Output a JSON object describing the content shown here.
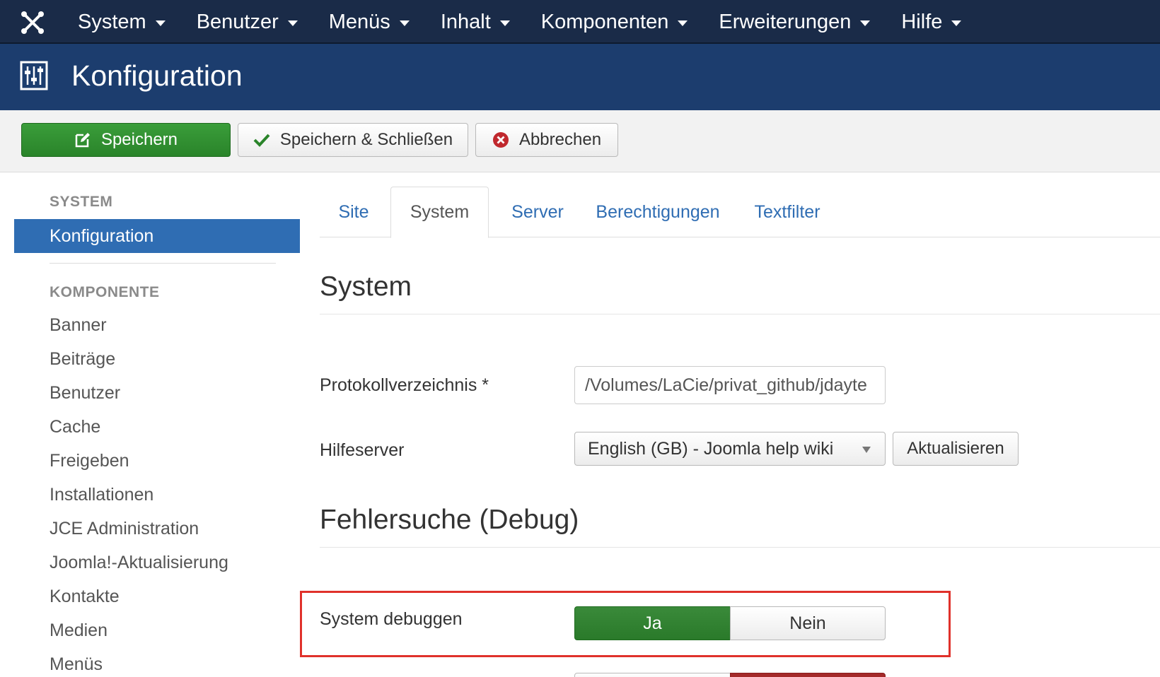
{
  "topnav": {
    "logo_icon": "joomla-logo-icon",
    "items": [
      {
        "label": "System"
      },
      {
        "label": "Benutzer"
      },
      {
        "label": "Menüs"
      },
      {
        "label": "Inhalt"
      },
      {
        "label": "Komponenten"
      },
      {
        "label": "Erweiterungen"
      },
      {
        "label": "Hilfe"
      }
    ]
  },
  "titlebar": {
    "icon": "sliders-icon",
    "title": "Konfiguration"
  },
  "toolbar": {
    "save_label": "Speichern",
    "save_close_label": "Speichern & Schließen",
    "cancel_label": "Abbrechen"
  },
  "sidebar": {
    "system_heading": "SYSTEM",
    "active_item": "Konfiguration",
    "component_heading": "KOMPONENTE",
    "items": [
      {
        "label": "Banner"
      },
      {
        "label": "Beiträge"
      },
      {
        "label": "Benutzer"
      },
      {
        "label": "Cache"
      },
      {
        "label": "Freigeben"
      },
      {
        "label": "Installationen"
      },
      {
        "label": "JCE Administration"
      },
      {
        "label": "Joomla!-Aktualisierung"
      },
      {
        "label": "Kontakte"
      },
      {
        "label": "Medien"
      },
      {
        "label": "Menüs"
      }
    ]
  },
  "tabs": [
    {
      "label": "Site",
      "active": false
    },
    {
      "label": "System",
      "active": true
    },
    {
      "label": "Server",
      "active": false
    },
    {
      "label": "Berechtigungen",
      "active": false
    },
    {
      "label": "Textfilter",
      "active": false
    }
  ],
  "section_system": {
    "title": "System",
    "log_label": "Protokollverzeichnis *",
    "log_value": "/Volumes/LaCie/privat_github/jdayte",
    "help_label": "Hilfeserver",
    "help_value": "English (GB) - Joomla help wiki",
    "refresh_label": "Aktualisieren"
  },
  "section_debug": {
    "title": "Fehlersuche (Debug)",
    "debug_label": "System debuggen",
    "yes_label": "Ja",
    "no_label": "Nein",
    "selected": "Ja"
  },
  "colors": {
    "topnav_bg": "#1a2b48",
    "titlebar_bg": "#1c3d6e",
    "save_green": "#2a842a",
    "active_blue": "#2f6db3",
    "highlight_red": "#e0312b",
    "cancel_red": "#c0282d"
  }
}
